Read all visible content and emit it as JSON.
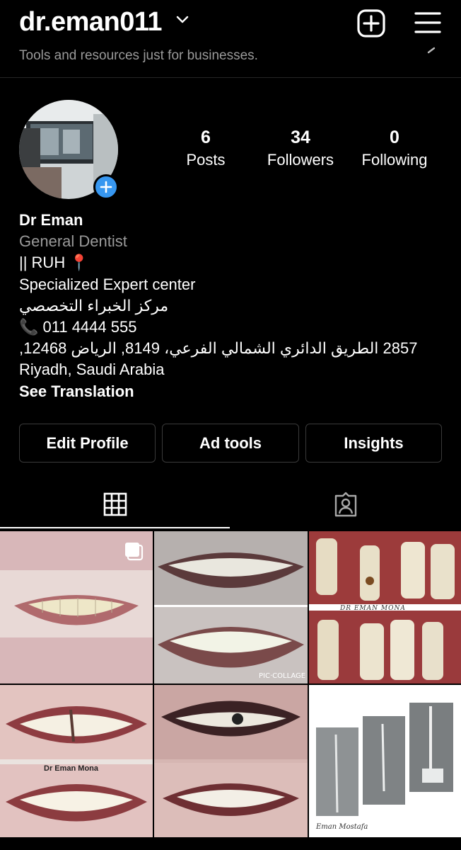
{
  "header": {
    "username": "dr.eman011",
    "icons": {
      "dropdown": "chevron-down-icon",
      "create": "plus-square-icon",
      "menu": "hamburger-menu-icon"
    }
  },
  "banner": {
    "text": "Tools and resources just for businesses."
  },
  "profile": {
    "stats": {
      "posts": {
        "value": "6",
        "label": "Posts"
      },
      "followers": {
        "value": "34",
        "label": "Followers"
      },
      "following": {
        "value": "0",
        "label": "Following"
      }
    },
    "name": "Dr Eman",
    "category": "General Dentist",
    "bio_lines": [
      "|| RUH 📍",
      "Specialized Expert center",
      "مركز الخبراء التخصصي",
      "📞 011 4444 555",
      "2857 الطريق الدائري الشمالي الفرعي، 8149, الرياض 12468,",
      "Riyadh, Saudi Arabia"
    ],
    "see_translation": "See Translation"
  },
  "actions": {
    "edit_profile": "Edit Profile",
    "ad_tools": "Ad tools",
    "insights": "Insights"
  },
  "tabs": {
    "grid": "grid-icon",
    "tagged": "tagged-person-icon",
    "active": "grid"
  },
  "posts": [
    {
      "type": "carousel",
      "labels": []
    },
    {
      "type": "photo",
      "labels": [
        "PIC·COLLAGE"
      ]
    },
    {
      "type": "photo",
      "labels": [
        "DR EMAN MONA"
      ]
    },
    {
      "type": "photo",
      "labels": [
        "Dr Eman Mona"
      ]
    },
    {
      "type": "photo",
      "labels": []
    },
    {
      "type": "photo",
      "labels": [
        "Eman Mostafa"
      ]
    }
  ],
  "colors": {
    "background": "#000000",
    "accent": "#3797f0",
    "secondary_text": "#9a9a9a",
    "border": "#3a3a3a"
  }
}
